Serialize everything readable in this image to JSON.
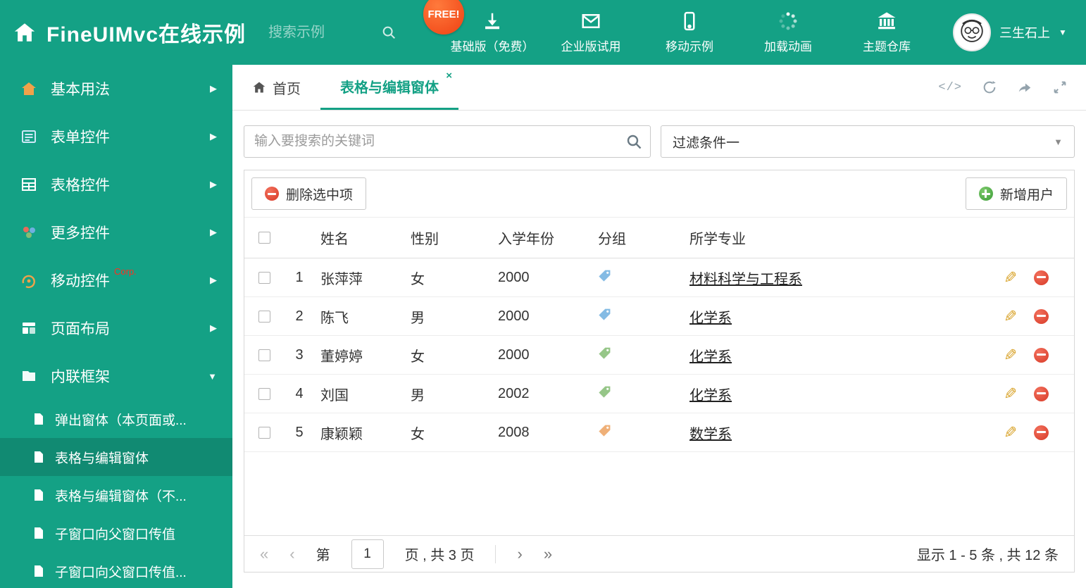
{
  "header": {
    "title": "FineUIMvc在线示例",
    "search_placeholder": "搜索示例",
    "free_badge": "FREE!",
    "nav": [
      {
        "label": "基础版（免费）",
        "icon": "download-icon"
      },
      {
        "label": "企业版试用",
        "icon": "envelope-icon"
      },
      {
        "label": "移动示例",
        "icon": "mobile-icon"
      },
      {
        "label": "加载动画",
        "icon": "spinner-icon"
      },
      {
        "label": "主题仓库",
        "icon": "bank-icon"
      }
    ],
    "user": {
      "name": "三生石上"
    }
  },
  "sidebar": {
    "items": [
      {
        "label": "基本用法"
      },
      {
        "label": "表单控件"
      },
      {
        "label": "表格控件"
      },
      {
        "label": "更多控件"
      },
      {
        "label": "移动控件",
        "tag": "Corp."
      },
      {
        "label": "页面布局"
      },
      {
        "label": "内联框架"
      }
    ],
    "subitems": [
      {
        "label": "弹出窗体（本页面或..."
      },
      {
        "label": "表格与编辑窗体"
      },
      {
        "label": "表格与编辑窗体（不..."
      },
      {
        "label": "子窗口向父窗口传值"
      },
      {
        "label": "子窗口向父窗口传值..."
      }
    ]
  },
  "tabs": [
    {
      "label": "首页"
    },
    {
      "label": "表格与编辑窗体"
    }
  ],
  "filters": {
    "search_placeholder": "输入要搜索的关键词",
    "dropdown_value": "过滤条件一"
  },
  "toolbar": {
    "delete_label": "删除选中项",
    "add_label": "新增用户"
  },
  "table": {
    "columns": [
      "姓名",
      "性别",
      "入学年份",
      "分组",
      "所学专业"
    ],
    "rows": [
      {
        "index": "1",
        "name": "张萍萍",
        "gender": "女",
        "year": "2000",
        "tag_color": "#6fb0e0",
        "major": "材料科学与工程系"
      },
      {
        "index": "2",
        "name": "陈飞",
        "gender": "男",
        "year": "2000",
        "tag_color": "#6fb0e0",
        "major": "化学系"
      },
      {
        "index": "3",
        "name": "董婷婷",
        "gender": "女",
        "year": "2000",
        "tag_color": "#84bd74",
        "major": "化学系"
      },
      {
        "index": "4",
        "name": "刘国",
        "gender": "男",
        "year": "2002",
        "tag_color": "#84bd74",
        "major": "化学系"
      },
      {
        "index": "5",
        "name": "康颖颖",
        "gender": "女",
        "year": "2008",
        "tag_color": "#eda361",
        "major": "数学系"
      }
    ]
  },
  "pagination": {
    "page_prefix": "第",
    "current_page": "1",
    "page_suffix": "页 , 共 3 页",
    "summary": "显示 1 - 5 条 , 共 12 条"
  },
  "icons": {
    "caret_down": "▼",
    "arrow_right": "▶",
    "pencil": "✎",
    "close": "×",
    "first": "«",
    "prev": "‹",
    "next": "›",
    "last": "»",
    "code": "</>"
  },
  "colors": {
    "brand_green": "#14a185",
    "active_sub": "#118a72",
    "free_badge": "#ef4113",
    "delete_red": "#d83a28",
    "add_green": "#3d9e38",
    "pencil_gold": "#d9a42c"
  }
}
